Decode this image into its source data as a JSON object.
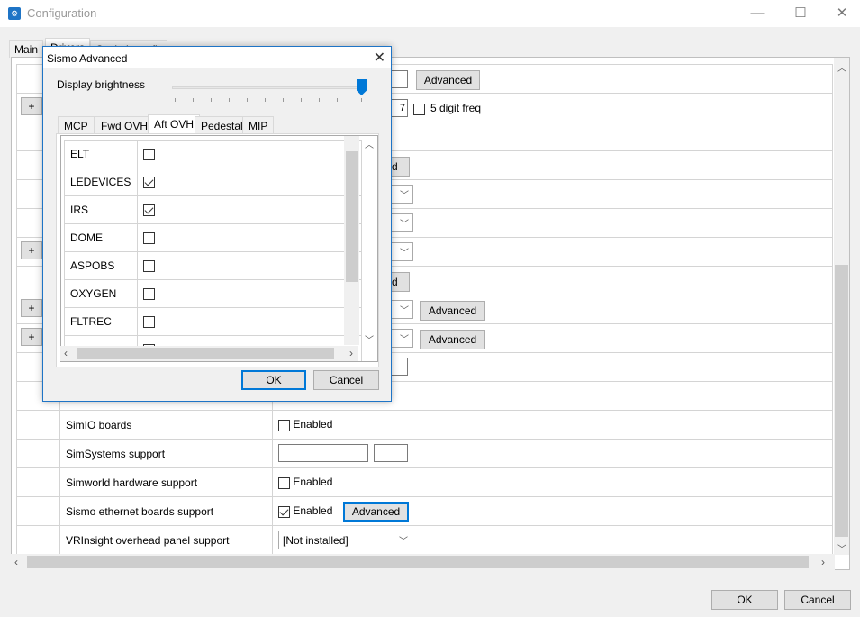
{
  "window": {
    "title": "Configuration",
    "minimize": "—",
    "maximize": "☐",
    "close": "✕"
  },
  "main_tabs": [
    "Main",
    "Drivers",
    "Cockpit config"
  ],
  "grid_rows": [
    {
      "label": "SimIO boards",
      "enabled_label": "Enabled"
    },
    {
      "label": "SimSystems support"
    },
    {
      "label": "Simworld hardware support",
      "enabled_label": "Enabled"
    },
    {
      "label": "Sismo ethernet boards support",
      "enabled_label": "Enabled",
      "advanced": "Advanced"
    },
    {
      "label": "VRInsight overhead panel support",
      "combo": "[Not installed]"
    }
  ],
  "grid_partial": {
    "advanced_top": "Advanced",
    "five_digit": "5 digit freq",
    "combo_advanced_1": "Advanced",
    "combo_advanced_2": "Advanced",
    "textbox_tail": "7",
    "btn_tail_1": "d",
    "btn_tail_2": "d",
    "plus": "+"
  },
  "footer": {
    "ok": "OK",
    "cancel": "Cancel"
  },
  "dialog": {
    "title": "Sismo Advanced",
    "close": "✕",
    "brightness_label": "Display brightness",
    "brightness_value": 1.0,
    "tabs": [
      "MCP",
      "Fwd OVH",
      "Aft OVH",
      "Pedestal",
      "MIP"
    ],
    "active_tab": "Aft OVH",
    "items": [
      {
        "name": "ELT",
        "checked": false
      },
      {
        "name": "LEDEVICES",
        "checked": true
      },
      {
        "name": "IRS",
        "checked": true
      },
      {
        "name": "DOME",
        "checked": false
      },
      {
        "name": "ASPOBS",
        "checked": false
      },
      {
        "name": "OXYGEN",
        "checked": false
      },
      {
        "name": "FLTREC",
        "checked": false
      }
    ],
    "ok": "OK",
    "cancel": "Cancel"
  }
}
